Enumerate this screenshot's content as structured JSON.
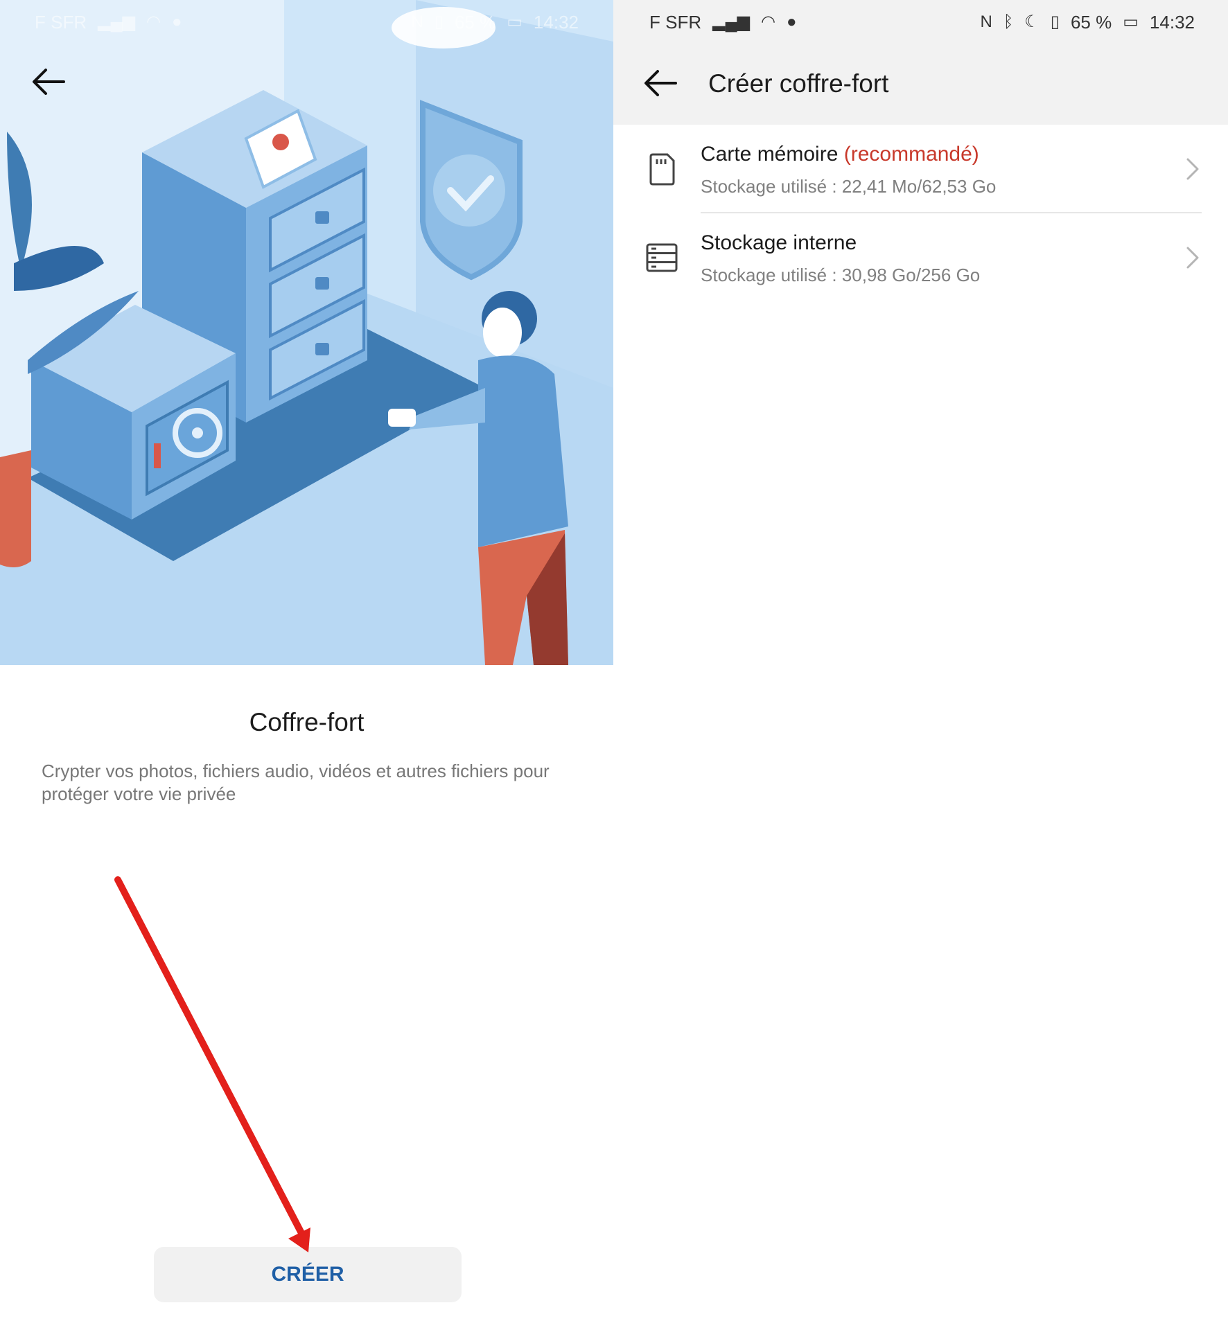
{
  "status_bar": {
    "carrier": "F SFR",
    "battery": "65 %",
    "time": "14:32"
  },
  "intro_screen": {
    "title": "Coffre-fort",
    "description": "Crypter vos photos, fichiers audio, vidéos et autres fichiers pour protéger votre vie privée",
    "create_button": "CRÉER",
    "back_icon": "arrow-left-icon"
  },
  "create_screen": {
    "title": "Créer coffre-fort",
    "back_icon": "arrow-left-icon",
    "items": [
      {
        "title": "Carte mémoire",
        "tag": "(recommandé)",
        "subtitle": "Stockage utilisé : 22,41 Mo/62,53 Go",
        "icon": "sd-card-icon"
      },
      {
        "title": "Stockage interne",
        "tag": "",
        "subtitle": "Stockage utilisé : 30,98 Go/256 Go",
        "icon": "internal-storage-icon"
      }
    ]
  },
  "colors": {
    "accent_blue": "#1f5fa6",
    "recommended_red": "#c8392b",
    "annotation_arrow": "#e3201b",
    "header_bg": "#f2f2f2"
  }
}
